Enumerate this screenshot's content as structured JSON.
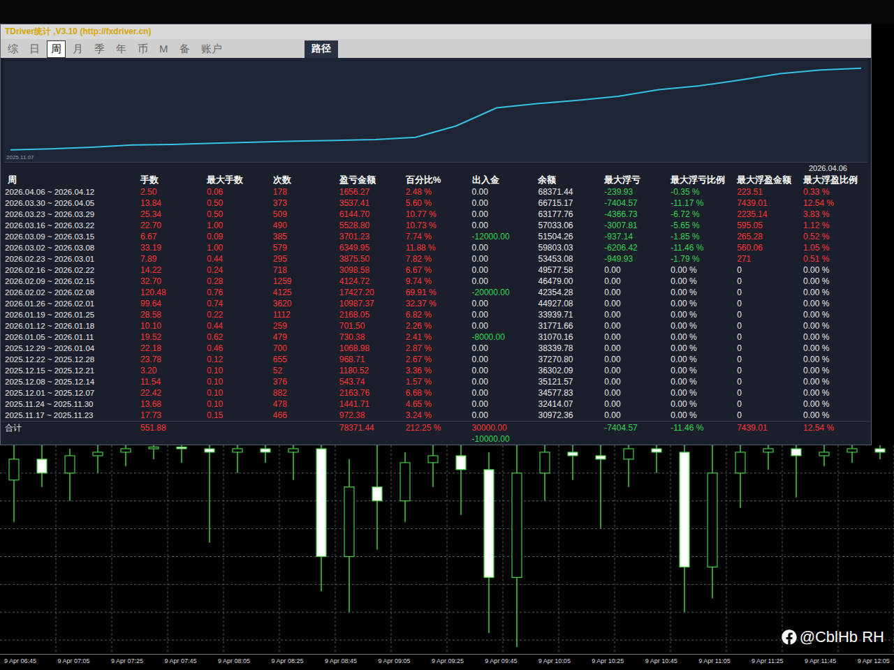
{
  "window": {
    "title": "TDriver统计 ,V3.10 (http://fxdriver.cn)"
  },
  "tabs": [
    {
      "label": "综",
      "selected": false
    },
    {
      "label": "日",
      "selected": false
    },
    {
      "label": "周",
      "selected": true
    },
    {
      "label": "月",
      "selected": false
    },
    {
      "label": "季",
      "selected": false
    },
    {
      "label": "年",
      "selected": false
    },
    {
      "label": "币",
      "selected": false
    },
    {
      "label": "M",
      "selected": false
    },
    {
      "label": "备",
      "selected": false
    },
    {
      "label": "账户",
      "selected": false
    }
  ],
  "path_button": "路径",
  "equity_chart": {
    "start_label": "2025.11.07",
    "values": [
      0,
      972.38,
      2414.09,
      4577.85,
      5121.59,
      6302.11,
      7270.82,
      8339.8,
      9070.18,
      9771.68,
      11939.73,
      22927.1,
      40354.3,
      44479.02,
      47577.6,
      51453.1,
      57803.05,
      61504.28,
      67033.08,
      73177.78,
      76715.19,
      78371.44
    ]
  },
  "table": {
    "period_header": "周",
    "report_date": "2026.04.06",
    "columns": [
      {
        "label": "手数",
        "kind": "signed"
      },
      {
        "label": "最大手数",
        "kind": "signed"
      },
      {
        "label": "次数",
        "kind": "signed"
      },
      {
        "label": "盈亏金额",
        "kind": "signed"
      },
      {
        "label": "百分比%",
        "kind": "signed"
      },
      {
        "label": "出入金",
        "kind": "signed"
      },
      {
        "label": "余额",
        "kind": "plain"
      },
      {
        "label": "最大浮亏",
        "kind": "signed"
      },
      {
        "label": "最大浮亏比例",
        "kind": "signed"
      },
      {
        "label": "最大浮盈金额",
        "kind": "signed"
      },
      {
        "label": "最大浮盈比例",
        "kind": "signed"
      }
    ],
    "rows": [
      {
        "period": "2026.04.06 ~ 2026.04.12",
        "cells": [
          "2.50",
          "0.06",
          "178",
          "1656.27",
          "2.48 %",
          "0.00",
          "68371.44",
          "-239.93",
          "-0.35 %",
          "223.51",
          "0.33 %"
        ]
      },
      {
        "period": "2026.03.30 ~ 2026.04.05",
        "cells": [
          "13.84",
          "0.50",
          "373",
          "3537.41",
          "5.60 %",
          "0.00",
          "66715.17",
          "-7404.57",
          "-11.17 %",
          "7439.01",
          "12.54 %"
        ]
      },
      {
        "period": "2026.03.23 ~ 2026.03.29",
        "cells": [
          "25.34",
          "0.50",
          "509",
          "6144.70",
          "10.77 %",
          "0.00",
          "63177.76",
          "-4366.73",
          "-6.72 %",
          "2235.14",
          "3.83 %"
        ]
      },
      {
        "period": "2026.03.16 ~ 2026.03.22",
        "cells": [
          "22.70",
          "1.00",
          "490",
          "5528.80",
          "10.73 %",
          "0.00",
          "57033.06",
          "-3007.81",
          "-5.65 %",
          "595.05",
          "1.12 %"
        ]
      },
      {
        "period": "2026.03.09 ~ 2026.03.15",
        "cells": [
          "6.67",
          "0.09",
          "385",
          "3701.23",
          "7.74 %",
          "-12000.00",
          "51504.26",
          "-937.14",
          "-1.85 %",
          "265.28",
          "0.52 %"
        ]
      },
      {
        "period": "2026.03.02 ~ 2026.03.08",
        "cells": [
          "33.19",
          "1.00",
          "579",
          "6349.95",
          "11.88 %",
          "0.00",
          "59803.03",
          "-6206.42",
          "-11.46 %",
          "560.06",
          "1.05 %"
        ]
      },
      {
        "period": "2026.02.23 ~ 2026.03.01",
        "cells": [
          "7.89",
          "0.44",
          "295",
          "3875.50",
          "7.82 %",
          "0.00",
          "53453.08",
          "-949.93",
          "-1.79 %",
          "271",
          "0.51 %"
        ]
      },
      {
        "period": "2026.02.16 ~ 2026.02.22",
        "cells": [
          "14.22",
          "0.24",
          "718",
          "3098.58",
          "6.67 %",
          "0.00",
          "49577.58",
          "0.00",
          "0.00 %",
          "0",
          "0.00 %"
        ]
      },
      {
        "period": "2026.02.09 ~ 2026.02.15",
        "cells": [
          "32.70",
          "0.28",
          "1259",
          "4124.72",
          "9.74 %",
          "0.00",
          "46479.00",
          "0.00",
          "0.00 %",
          "0",
          "0.00 %"
        ]
      },
      {
        "period": "2026.02.02 ~ 2026.02.08",
        "cells": [
          "120.48",
          "0.76",
          "4125",
          "17427.20",
          "69.91 %",
          "-20000.00",
          "42354.28",
          "0.00",
          "0.00 %",
          "0",
          "0.00 %"
        ]
      },
      {
        "period": "2026.01.26 ~ 2026.02.01",
        "cells": [
          "99.64",
          "0.74",
          "3620",
          "10987.37",
          "32.37 %",
          "0.00",
          "44927.08",
          "0.00",
          "0.00 %",
          "0",
          "0.00 %"
        ]
      },
      {
        "period": "2026.01.19 ~ 2026.01.25",
        "cells": [
          "28.58",
          "0.22",
          "1112",
          "2168.05",
          "6.82 %",
          "0.00",
          "33939.71",
          "0.00",
          "0.00 %",
          "0",
          "0.00 %"
        ]
      },
      {
        "period": "2026.01.12 ~ 2026.01.18",
        "cells": [
          "10.10",
          "0.44",
          "259",
          "701.50",
          "2.26 %",
          "0.00",
          "31771.66",
          "0.00",
          "0.00 %",
          "0",
          "0.00 %"
        ]
      },
      {
        "period": "2026.01.05 ~ 2026.01.11",
        "cells": [
          "19.52",
          "0.62",
          "479",
          "730.38",
          "2.41 %",
          "-8000.00",
          "31070.16",
          "0.00",
          "0.00 %",
          "0",
          "0.00 %"
        ]
      },
      {
        "period": "2025.12.29 ~ 2026.01.04",
        "cells": [
          "22.18",
          "0.46",
          "700",
          "1068.98",
          "2.87 %",
          "0.00",
          "38339.78",
          "0.00",
          "0.00 %",
          "0",
          "0.00 %"
        ]
      },
      {
        "period": "2025.12.22 ~ 2025.12.28",
        "cells": [
          "23.78",
          "0.12",
          "655",
          "968.71",
          "2.67 %",
          "0.00",
          "37270.80",
          "0.00",
          "0.00 %",
          "0",
          "0.00 %"
        ]
      },
      {
        "period": "2025.12.15 ~ 2025.12.21",
        "cells": [
          "3.20",
          "0.10",
          "52",
          "1180.52",
          "3.36 %",
          "0.00",
          "36302.09",
          "0.00",
          "0.00 %",
          "0",
          "0.00 %"
        ]
      },
      {
        "period": "2025.12.08 ~ 2025.12.14",
        "cells": [
          "11.54",
          "0.10",
          "376",
          "543.74",
          "1.57 %",
          "0.00",
          "35121.57",
          "0.00",
          "0.00 %",
          "0",
          "0.00 %"
        ]
      },
      {
        "period": "2025.12.01 ~ 2025.12.07",
        "cells": [
          "22.42",
          "0.10",
          "882",
          "2163.76",
          "6.68 %",
          "0.00",
          "34577.83",
          "0.00",
          "0.00 %",
          "0",
          "0.00 %"
        ]
      },
      {
        "period": "2025.11.24 ~ 2025.11.30",
        "cells": [
          "13.68",
          "0.10",
          "478",
          "1441.71",
          "4.65 %",
          "0.00",
          "32414.07",
          "0.00",
          "0.00 %",
          "0",
          "0.00 %"
        ]
      },
      {
        "period": "2025.11.17 ~ 2025.11.23",
        "cells": [
          "17.73",
          "0.15",
          "466",
          "972.38",
          "3.24 %",
          "0.00",
          "30972.36",
          "0.00",
          "0.00 %",
          "0",
          "0.00 %"
        ]
      }
    ],
    "total": {
      "period": "合计",
      "cells": [
        "551.88",
        "",
        "",
        "78371.44",
        "212.25 %",
        [
          "30000.00",
          "-10000.00"
        ],
        "",
        "-7404.57",
        "-11.46 %",
        "7439.01",
        "12.54 %"
      ]
    }
  },
  "price_chart": {
    "min": 4700,
    "max": 4760,
    "candles": [
      {
        "open": 4750,
        "high": 4760,
        "low": 4738,
        "close": 4756
      },
      {
        "open": 4756,
        "high": 4760,
        "low": 4748,
        "close": 4752
      },
      {
        "open": 4752,
        "high": 4759,
        "low": 4744,
        "close": 4757
      },
      {
        "open": 4757,
        "high": 4760,
        "low": 4752,
        "close": 4758
      },
      {
        "open": 4758,
        "high": 4760,
        "low": 4754,
        "close": 4759
      },
      {
        "open": 4759,
        "high": 4760,
        "low": 4756,
        "close": 4759.5
      },
      {
        "open": 4759.5,
        "high": 4760,
        "low": 4755,
        "close": 4759
      },
      {
        "open": 4759,
        "high": 4760,
        "low": 4732,
        "close": 4758
      },
      {
        "open": 4758,
        "high": 4760,
        "low": 4752,
        "close": 4759
      },
      {
        "open": 4759,
        "high": 4760,
        "low": 4755,
        "close": 4758
      },
      {
        "open": 4758,
        "high": 4760,
        "low": 4750,
        "close": 4759
      },
      {
        "open": 4759,
        "high": 4760,
        "low": 4718,
        "close": 4728
      },
      {
        "open": 4728,
        "high": 4756,
        "low": 4712,
        "close": 4748
      },
      {
        "open": 4748,
        "high": 4760,
        "low": 4730,
        "close": 4744
      },
      {
        "open": 4744,
        "high": 4758,
        "low": 4738,
        "close": 4755
      },
      {
        "open": 4755,
        "high": 4760,
        "low": 4748,
        "close": 4757
      },
      {
        "open": 4757,
        "high": 4760,
        "low": 4740,
        "close": 4753
      },
      {
        "open": 4753,
        "high": 4758,
        "low": 4706,
        "close": 4722
      },
      {
        "open": 4722,
        "high": 4760,
        "low": 4702,
        "close": 4752
      },
      {
        "open": 4752,
        "high": 4760,
        "low": 4744,
        "close": 4758
      },
      {
        "open": 4758,
        "high": 4760,
        "low": 4750,
        "close": 4757
      },
      {
        "open": 4757,
        "high": 4760,
        "low": 4736,
        "close": 4756
      },
      {
        "open": 4756,
        "high": 4760,
        "low": 4748,
        "close": 4759
      },
      {
        "open": 4759,
        "high": 4760,
        "low": 4752,
        "close": 4758
      },
      {
        "open": 4758,
        "high": 4760,
        "low": 4712,
        "close": 4725
      },
      {
        "open": 4725,
        "high": 4760,
        "low": 4716,
        "close": 4752
      },
      {
        "open": 4752,
        "high": 4760,
        "low": 4742,
        "close": 4758
      },
      {
        "open": 4758,
        "high": 4760,
        "low": 4753,
        "close": 4759
      },
      {
        "open": 4759,
        "high": 4760,
        "low": 4745,
        "close": 4757
      },
      {
        "open": 4757,
        "high": 4760,
        "low": 4754,
        "close": 4758
      },
      {
        "open": 4758,
        "high": 4760,
        "low": 4755,
        "close": 4759
      },
      {
        "open": 4759,
        "high": 4760,
        "low": 4756,
        "close": 4758
      }
    ],
    "time_labels": [
      "9 Apr 06:45",
      "9 Apr 07:05",
      "9 Apr 07:25",
      "9 Apr 07:45",
      "9 Apr 08:05",
      "9 Apr 08:25",
      "9 Apr 08:45",
      "9 Apr 09:05",
      "9 Apr 09:25",
      "9 Apr 09:45",
      "9 Apr 10:05",
      "9 Apr 10:25",
      "9 Apr 10:45",
      "9 Apr 11:05",
      "9 Apr 11:25",
      "9 Apr 11:45",
      "9 Apr 12:05"
    ]
  },
  "watermark": "@CblHb RH"
}
